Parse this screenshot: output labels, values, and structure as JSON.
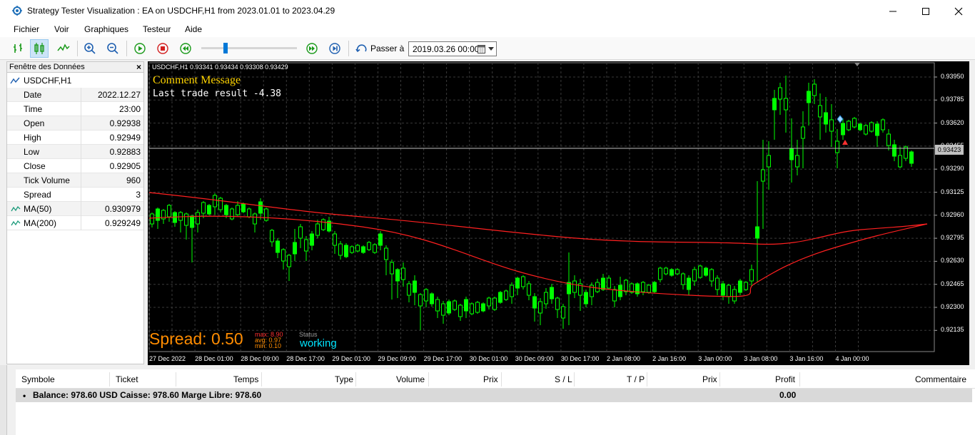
{
  "window": {
    "title": "Strategy Tester Visualization : EA on USDCHF,H1 from 2023.01.01 to 2023.04.29"
  },
  "menu": [
    "Fichier",
    "Voir",
    "Graphiques",
    "Testeur",
    "Aide"
  ],
  "toolbar": {
    "goto_label": "Passer à",
    "goto_date": "2019.03.26 00:00",
    "speed_fraction": 0.25
  },
  "data_window": {
    "title": "Fenêtre des Données",
    "symbol": "USDCHF,H1",
    "rows": [
      {
        "label": "Date",
        "value": "2022.12.27"
      },
      {
        "label": "Time",
        "value": "23:00"
      },
      {
        "label": "Open",
        "value": "0.92938"
      },
      {
        "label": "High",
        "value": "0.92949"
      },
      {
        "label": "Low",
        "value": "0.92883"
      },
      {
        "label": "Close",
        "value": "0.92905"
      },
      {
        "label": "Tick Volume",
        "value": "960"
      },
      {
        "label": "Spread",
        "value": "3"
      },
      {
        "label": "MA(50)",
        "value": "0.930979"
      },
      {
        "label": "MA(200)",
        "value": "0.929249"
      }
    ]
  },
  "chart": {
    "info": "USDCHF,H1  0.93341 0.93434 0.93308 0.93429",
    "comment_title": "Comment Message",
    "comment_line": "Last trade result -4.38",
    "spread_text": "Spread: 0.50",
    "stats": [
      {
        "label": "max:",
        "value": "8.90"
      },
      {
        "label": "avg:",
        "value": "0.97"
      },
      {
        "label": "min:",
        "value": "0.10"
      }
    ],
    "status_label": "Status",
    "status_value": "working",
    "current_price": "0.93423",
    "price_labels": [
      "0.93950",
      "0.93785",
      "0.93620",
      "0.93455",
      "0.93290",
      "0.93125",
      "0.92960",
      "0.92795",
      "0.92630",
      "0.92465",
      "0.92300",
      "0.92135"
    ],
    "time_labels": [
      "27 Dec 2022",
      "28 Dec 01:00",
      "28 Dec 09:00",
      "28 Dec 17:00",
      "29 Dec 01:00",
      "29 Dec 09:00",
      "29 Dec 17:00",
      "30 Dec 01:00",
      "30 Dec 09:00",
      "30 Dec 17:00",
      "2 Jan 08:00",
      "2 Jan 16:00",
      "3 Jan 00:00",
      "3 Jan 08:00",
      "3 Jan 16:00",
      "4 Jan 00:00"
    ],
    "colors": {
      "candles": "#00ff00",
      "ma": "#ff2020",
      "grid": "#3a3a3a"
    }
  },
  "trades_panel": {
    "headers": [
      "Symbole",
      "Ticket",
      "Temps",
      "Type",
      "Volume",
      "Prix",
      "S / L",
      "T / P",
      "Prix",
      "Profit",
      "Commentaire"
    ],
    "balance_text": "Balance: 978.60 USD  Caisse: 978.60  Marge Libre: 978.60",
    "profit": "0.00"
  }
}
